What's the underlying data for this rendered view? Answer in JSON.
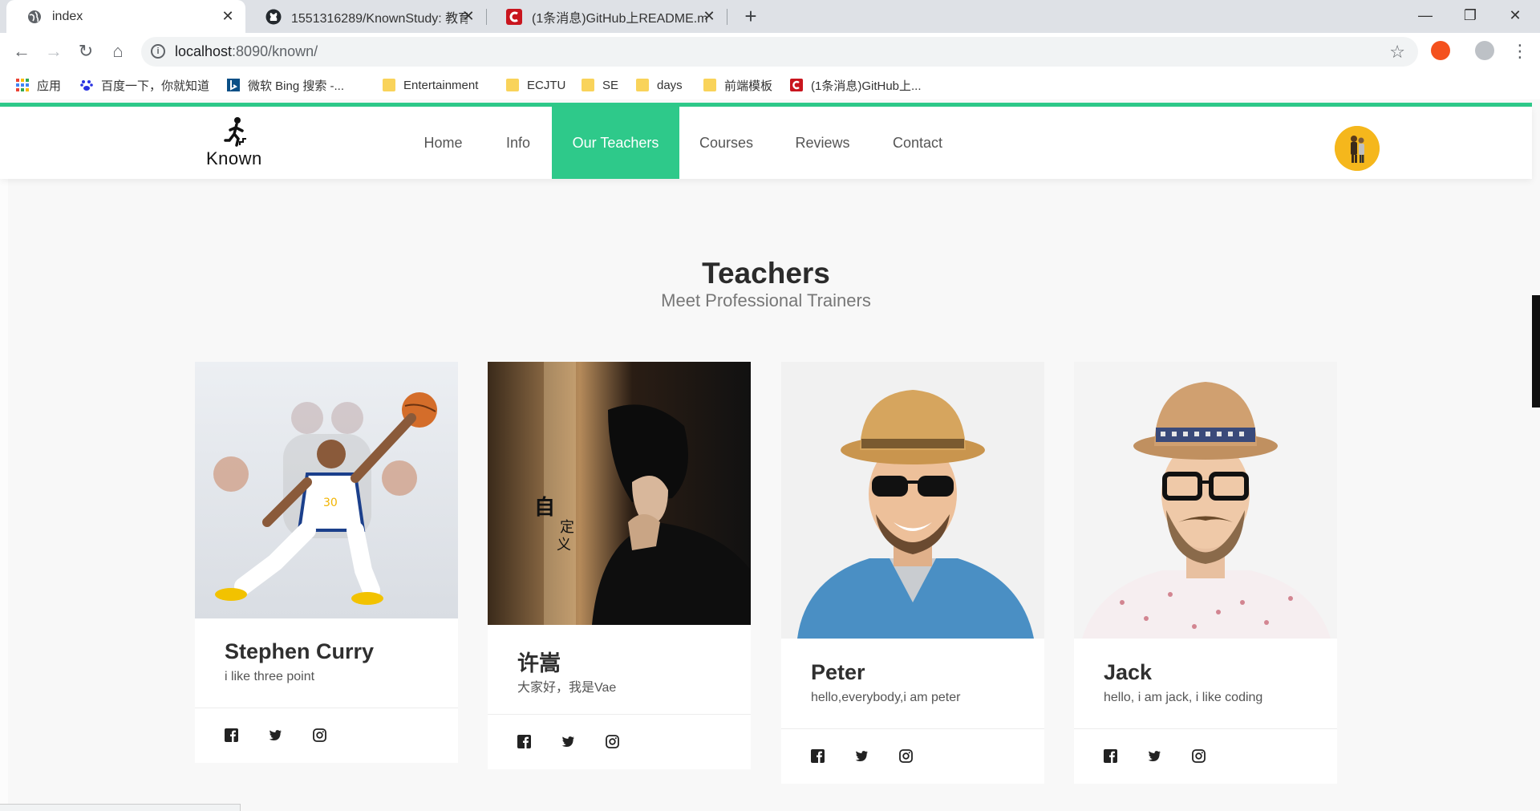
{
  "browser": {
    "tabs": [
      {
        "title": "index",
        "icon": "globe-icon",
        "active": true
      },
      {
        "title": "1551316289/KnownStudy: 教育",
        "icon": "github-icon",
        "active": false
      },
      {
        "title": "(1条消息)GitHub上README.md",
        "icon": "csdn-icon",
        "active": false
      }
    ],
    "url_host": "localhost",
    "url_path": ":8090/known/",
    "bookmarks": [
      {
        "label": "应用",
        "icon": "apps-grid-icon"
      },
      {
        "label": "百度一下，你就知道",
        "icon": "baidu-paw-icon"
      },
      {
        "label": "微软 Bing 搜索 -...",
        "icon": "bing-icon"
      },
      {
        "label": "Entertainment",
        "icon": "folder-icon"
      },
      {
        "label": "ECJTU",
        "icon": "folder-icon"
      },
      {
        "label": "SE",
        "icon": "folder-icon"
      },
      {
        "label": "days",
        "icon": "folder-icon"
      },
      {
        "label": "前端模板",
        "icon": "folder-icon"
      },
      {
        "label": "(1条消息)GitHub上...",
        "icon": "csdn-icon"
      }
    ]
  },
  "site": {
    "logo_text": "Known",
    "nav": [
      "Home",
      "Info",
      "Our Teachers",
      "Courses",
      "Reviews",
      "Contact"
    ],
    "active_nav": "Our Teachers",
    "accent_color": "#2ec98a"
  },
  "section": {
    "title": "Teachers",
    "subtitle": "Meet Professional Trainers"
  },
  "teachers": [
    {
      "name": "Stephen Curry",
      "desc": "i like three point"
    },
    {
      "name": "许嵩",
      "desc": "大家好，我是Vae"
    },
    {
      "name": "Peter",
      "desc": "hello,everybody,i am peter"
    },
    {
      "name": "Jack",
      "desc": "hello, i am jack, i like coding"
    }
  ],
  "social_icons": [
    "facebook-icon",
    "twitter-icon",
    "instagram-icon"
  ]
}
